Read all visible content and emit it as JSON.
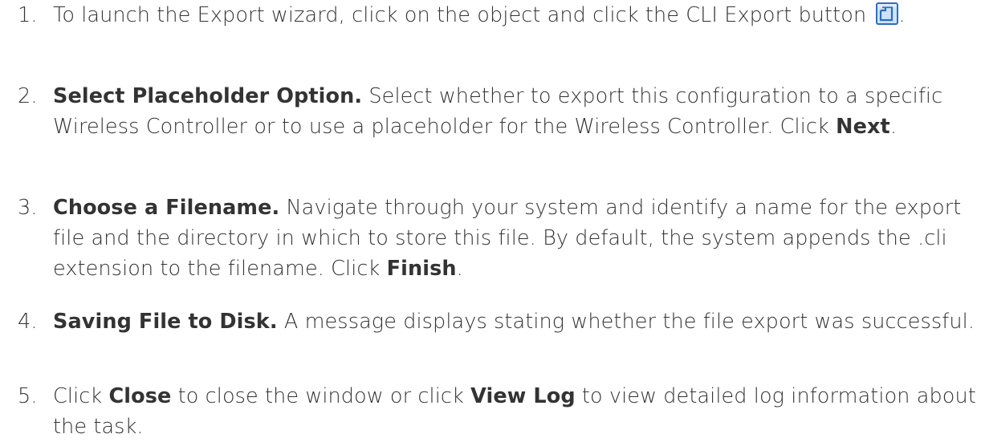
{
  "steps": [
    {
      "number": "1.",
      "text_before": "To launch the Export wizard, click on the object and click the CLI Export button",
      "icon": "cli-export-icon",
      "text_after": "."
    },
    {
      "number": "2.",
      "heading": "Select Placeholder Option.",
      "text": " Select whether to export this configuration to a specific Wireless Controller or to use a placeholder for the Wireless Controller. Click ",
      "action": "Next",
      "text_after": "."
    },
    {
      "number": "3.",
      "heading": "Choose a Filename.",
      "text": " Navigate through your system and identify a name for the export file and the directory in which to store this file. By default, the system appends the .cli extension to the filename. Click ",
      "action": "Finish",
      "text_after": "."
    },
    {
      "number": "4.",
      "heading": "Saving File to Disk.",
      "text": " A message displays stating whether the file export was successful."
    },
    {
      "number": "5.",
      "text_before": "Click ",
      "action1": "Close",
      "text_middle": " to close the window or click ",
      "action2": "View Log",
      "text_after": " to view detailed log information about the task."
    }
  ],
  "colors": {
    "text": "#333333",
    "icon_blue": "#2f6fb8",
    "icon_light": "#cfe3f7"
  }
}
